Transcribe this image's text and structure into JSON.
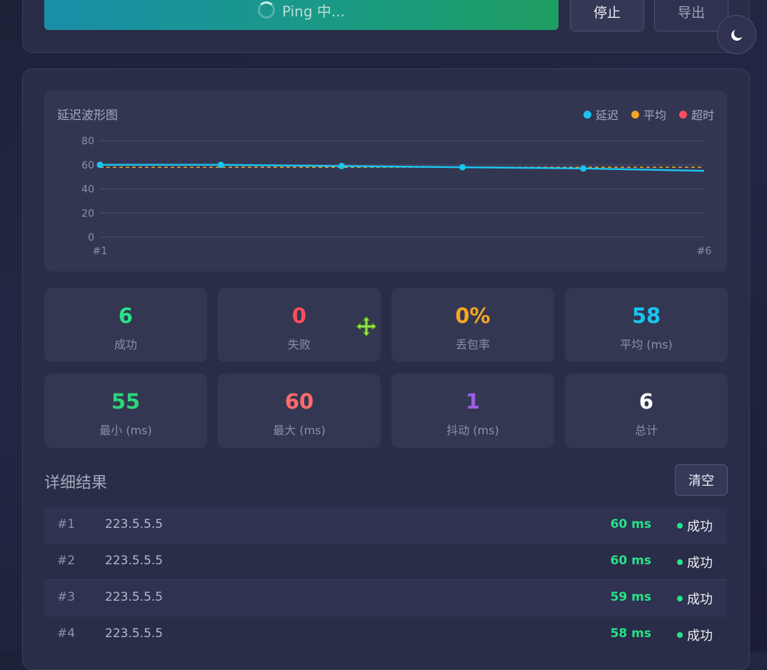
{
  "controls": {
    "ping_label": "Ping 中...",
    "stop_label": "停止",
    "export_label": "导出"
  },
  "chart_data": {
    "type": "line",
    "title": "延迟波形图",
    "legend": [
      {
        "name": "延迟",
        "color": "#19c5f0"
      },
      {
        "name": "平均",
        "color": "#f5a623"
      },
      {
        "name": "超时",
        "color": "#ff4d5e"
      }
    ],
    "x": [
      "#1",
      "#2",
      "#3",
      "#4",
      "#5",
      "#6"
    ],
    "x_tick_labels": [
      "#1",
      "#6"
    ],
    "series": [
      {
        "name": "延迟",
        "values": [
          60,
          60,
          59,
          58,
          57,
          55
        ]
      },
      {
        "name": "平均",
        "values": [
          58,
          58,
          58,
          58,
          58,
          58
        ]
      }
    ],
    "yticks": [
      0,
      20,
      40,
      60,
      80
    ],
    "ylim": [
      0,
      80
    ],
    "grid": true,
    "legend_position": "top-right"
  },
  "stats": [
    {
      "value": "6",
      "label": "成功",
      "color": "#27e28a"
    },
    {
      "value": "0",
      "label": "失败",
      "color": "#ff4d5e"
    },
    {
      "value": "0%",
      "label": "丢包率",
      "color": "#f5a623"
    },
    {
      "value": "58",
      "label": "平均 (ms)",
      "color": "#19c5f0"
    },
    {
      "value": "55",
      "label": "最小 (ms)",
      "color": "#2ed47a"
    },
    {
      "value": "60",
      "label": "最大 (ms)",
      "color": "#ff6b6b"
    },
    {
      "value": "1",
      "label": "抖动 (ms)",
      "color": "#9b5de5"
    },
    {
      "value": "6",
      "label": "总计",
      "color": "#ffffff"
    }
  ],
  "results": {
    "title": "详细结果",
    "clear_label": "清空",
    "rows": [
      {
        "index": "#1",
        "ip": "223.5.5.5",
        "latency": "60 ms",
        "status": "成功"
      },
      {
        "index": "#2",
        "ip": "223.5.5.5",
        "latency": "60 ms",
        "status": "成功"
      },
      {
        "index": "#3",
        "ip": "223.5.5.5",
        "latency": "59 ms",
        "status": "成功"
      },
      {
        "index": "#4",
        "ip": "223.5.5.5",
        "latency": "58 ms",
        "status": "成功"
      }
    ]
  }
}
